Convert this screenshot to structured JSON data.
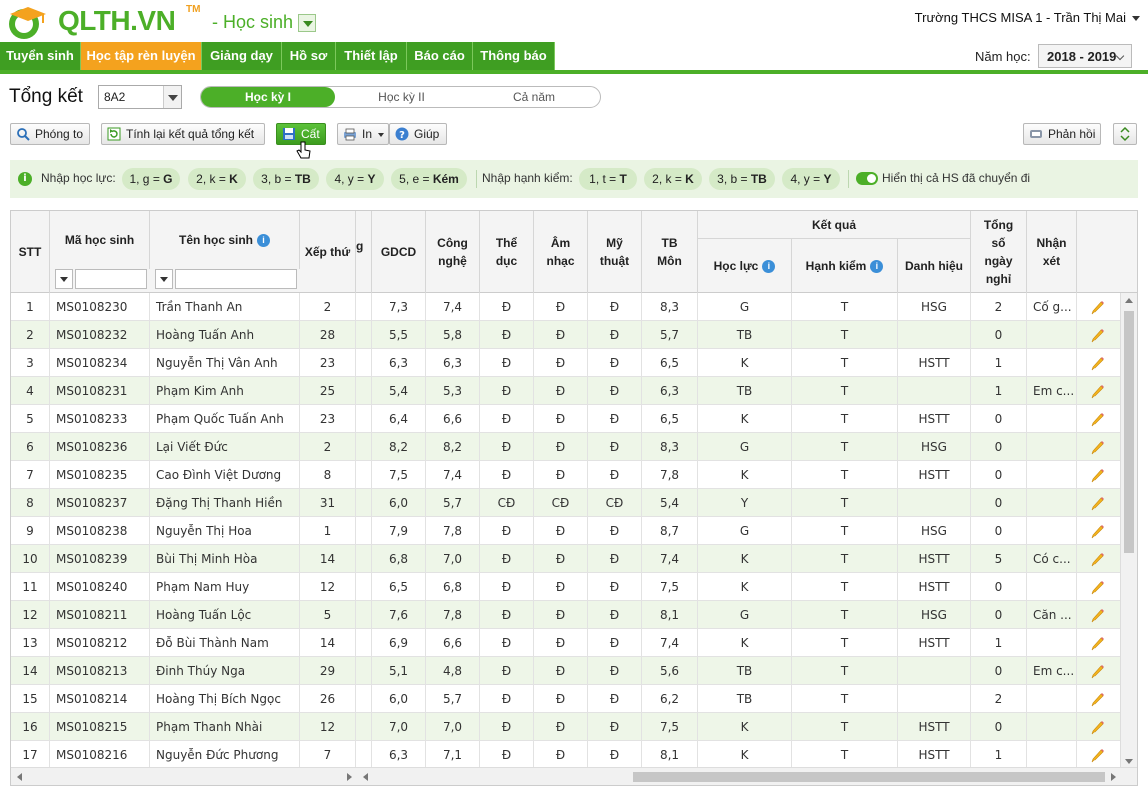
{
  "header": {
    "logo_text": "QLTH.VN",
    "logo_tm": "TM",
    "role": "- Học sinh",
    "school_user": "Trường THCS MISA 1 - Trần Thị Mai"
  },
  "menu": {
    "tabs": [
      {
        "label": "Tuyển sinh"
      },
      {
        "label": "Học tập rèn luyện"
      },
      {
        "label": "Giảng dạy"
      },
      {
        "label": "Hồ sơ"
      },
      {
        "label": "Thiết lập"
      },
      {
        "label": "Báo cáo"
      },
      {
        "label": "Thông báo"
      }
    ],
    "active": "Học tập rèn luyện",
    "year_label": "Năm học:",
    "year_value": "2018 - 2019"
  },
  "page": {
    "title": "Tổng kết",
    "class_value": "8A2",
    "terms": [
      "Học kỳ I",
      "Học kỳ II",
      "Cả năm"
    ],
    "active_term": "Học kỳ I"
  },
  "toolbar": {
    "zoom": "Phóng to",
    "recalc": "Tính lại kết quả tổng kết",
    "save": "Cất",
    "print": "In",
    "help": "Giúp",
    "feedback": "Phản hồi"
  },
  "infobar": {
    "hoc_luc_label": "Nhập học lực:",
    "hoc_luc_chips": [
      {
        "key": "1, g =",
        "val": "G"
      },
      {
        "key": "2, k =",
        "val": "K"
      },
      {
        "key": "3, b =",
        "val": "TB"
      },
      {
        "key": "4, y =",
        "val": "Y"
      },
      {
        "key": "5, e =",
        "val": "Kém"
      }
    ],
    "hanh_kiem_label": "Nhập hạnh kiểm:",
    "hanh_kiem_chips": [
      {
        "key": "1, t =",
        "val": "T"
      },
      {
        "key": "2, k =",
        "val": "K"
      },
      {
        "key": "3, b =",
        "val": "TB"
      },
      {
        "key": "4, y =",
        "val": "Y"
      }
    ],
    "toggle_label": "Hiển thị cả HS đã chuyển đi"
  },
  "table": {
    "headers": {
      "stt": "STT",
      "ma": "Mã học sinh",
      "ten": "Tên học sinh",
      "xep_thu": "Xếp thứ",
      "partial": "g",
      "gdcd": "GDCD",
      "cong_nghe": "Công nghệ",
      "the_duc": "Thể dục",
      "am_nhac": "Âm nhạc",
      "my_thuat": "Mỹ thuật",
      "tb_mon": "TB Môn",
      "ket_qua": "Kết quả",
      "hoc_luc": "Học lực",
      "hanh_kiem": "Hạnh kiểm",
      "danh_hieu": "Danh hiệu",
      "tong_so": "Tổng số ngày nghỉ",
      "nhan_xet": "Nhận xét"
    },
    "rows": [
      [
        "1",
        "MS0108230",
        "Trần Thanh An",
        "2",
        "7,3",
        "7,4",
        "Đ",
        "Đ",
        "Đ",
        "8,3",
        "G",
        "T",
        "HSG",
        "2",
        "Cố g..."
      ],
      [
        "2",
        "MS0108232",
        "Hoàng Tuấn Anh",
        "28",
        "5,5",
        "5,8",
        "Đ",
        "Đ",
        "Đ",
        "5,7",
        "TB",
        "T",
        "",
        "0",
        ""
      ],
      [
        "3",
        "MS0108234",
        "Nguyễn Thị Vân Anh",
        "23",
        "6,3",
        "6,3",
        "Đ",
        "Đ",
        "Đ",
        "6,5",
        "K",
        "T",
        "HSTT",
        "1",
        ""
      ],
      [
        "4",
        "MS0108231",
        "Phạm Kim Anh",
        "25",
        "5,4",
        "5,3",
        "Đ",
        "Đ",
        "Đ",
        "6,3",
        "TB",
        "T",
        "",
        "1",
        "Em c..."
      ],
      [
        "5",
        "MS0108233",
        "Phạm Quốc Tuấn Anh",
        "23",
        "6,4",
        "6,6",
        "Đ",
        "Đ",
        "Đ",
        "6,5",
        "K",
        "T",
        "HSTT",
        "0",
        ""
      ],
      [
        "6",
        "MS0108236",
        "Lại Viết Đức",
        "2",
        "8,2",
        "8,2",
        "Đ",
        "Đ",
        "Đ",
        "8,3",
        "G",
        "T",
        "HSG",
        "0",
        ""
      ],
      [
        "7",
        "MS0108235",
        "Cao Đình Việt Dương",
        "8",
        "7,5",
        "7,4",
        "Đ",
        "Đ",
        "Đ",
        "7,8",
        "K",
        "T",
        "HSTT",
        "0",
        ""
      ],
      [
        "8",
        "MS0108237",
        "Đặng Thị Thanh Hiền",
        "31",
        "6,0",
        "5,7",
        "CĐ",
        "CĐ",
        "CĐ",
        "5,4",
        "Y",
        "T",
        "",
        "0",
        ""
      ],
      [
        "9",
        "MS0108238",
        "Nguyễn Thị Hoa",
        "1",
        "7,9",
        "7,8",
        "Đ",
        "Đ",
        "Đ",
        "8,7",
        "G",
        "T",
        "HSG",
        "0",
        ""
      ],
      [
        "10",
        "MS0108239",
        "Bùi Thị Minh Hòa",
        "14",
        "6,8",
        "7,0",
        "Đ",
        "Đ",
        "Đ",
        "7,4",
        "K",
        "T",
        "HSTT",
        "5",
        "Có c..."
      ],
      [
        "11",
        "MS0108240",
        "Phạm Nam Huy",
        "12",
        "6,5",
        "6,8",
        "Đ",
        "Đ",
        "Đ",
        "7,5",
        "K",
        "T",
        "HSTT",
        "0",
        ""
      ],
      [
        "12",
        "MS0108211",
        "Hoàng Tuấn Lộc",
        "5",
        "7,6",
        "7,8",
        "Đ",
        "Đ",
        "Đ",
        "8,1",
        "G",
        "T",
        "HSG",
        "0",
        "Căn ..."
      ],
      [
        "13",
        "MS0108212",
        "Đỗ Bùi Thành Nam",
        "14",
        "6,9",
        "6,6",
        "Đ",
        "Đ",
        "Đ",
        "7,4",
        "K",
        "T",
        "HSTT",
        "1",
        ""
      ],
      [
        "14",
        "MS0108213",
        "Đinh Thúy Nga",
        "29",
        "5,1",
        "4,8",
        "Đ",
        "Đ",
        "Đ",
        "5,6",
        "TB",
        "T",
        "",
        "0",
        "Em c..."
      ],
      [
        "15",
        "MS0108214",
        "Hoàng Thị Bích Ngọc",
        "26",
        "6,0",
        "5,7",
        "Đ",
        "Đ",
        "Đ",
        "6,2",
        "TB",
        "T",
        "",
        "2",
        ""
      ],
      [
        "16",
        "MS0108215",
        "Phạm Thanh Nhài",
        "12",
        "7,0",
        "7,0",
        "Đ",
        "Đ",
        "Đ",
        "7,5",
        "K",
        "T",
        "HSTT",
        "0",
        ""
      ],
      [
        "17",
        "MS0108216",
        "Nguyễn Đức Phương",
        "7",
        "6,3",
        "7,1",
        "Đ",
        "Đ",
        "Đ",
        "8,1",
        "K",
        "T",
        "HSTT",
        "1",
        ""
      ]
    ]
  },
  "colors": {
    "brand_green": "#4caf28",
    "active_orange": "#f4a21e",
    "row_alt": "#eef6e8"
  }
}
